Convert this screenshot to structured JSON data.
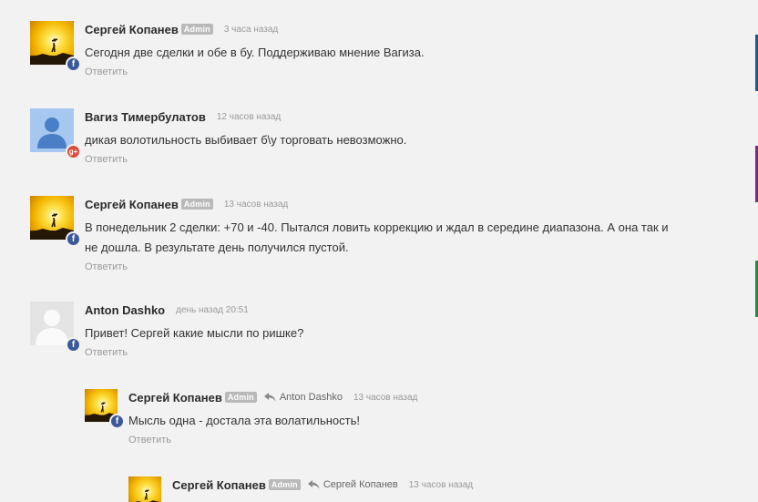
{
  "comments": [
    {
      "author": "Сергей Копанев",
      "badge": "Admin",
      "time": "3 часа назад",
      "text_lines": [
        "Сегодня две сделки и обе в бу. Поддерживаю мнение Вагиза."
      ],
      "reply_label": "Ответить",
      "avatar": "sunset-avatar",
      "network": "facebook"
    },
    {
      "author": "Вагиз Тимербулатов",
      "time": "12 часов назад",
      "text_lines": [
        "дикая волотильность  выбивает б\\у  торговать невозможно."
      ],
      "reply_label": "Ответить",
      "avatar": "default-user-avatar",
      "network": "google-plus"
    },
    {
      "author": "Сергей Копанев",
      "badge": "Admin",
      "time": "13 часов назад",
      "text_lines": [
        "В понедельник 2 сделки: +70 и -40. Пытался ловить коррекцию и ждал в середине диапазона. А она так и",
        "не дошла. В результате день получился пустой."
      ],
      "reply_label": "Ответить",
      "avatar": "sunset-avatar",
      "network": "facebook"
    },
    {
      "author": "Anton Dashko",
      "time": "день назад 20:51",
      "text_lines": [
        "Привет! Сергей какие мысли по ришке?"
      ],
      "reply_label": "Ответить",
      "avatar": "blank-silhouette-avatar",
      "network": "facebook"
    },
    {
      "author": "Сергей Копанев",
      "badge": "Admin",
      "reply_to": "Anton Dashko",
      "time": "13 часов назад",
      "text_lines": [
        "Мысль одна - достала эта волатильность!"
      ],
      "reply_label": "Ответить",
      "avatar": "sunset-avatar",
      "network": "facebook"
    },
    {
      "author": "Сергей Копанев",
      "badge": "Admin",
      "reply_to": "Сергей Копанев",
      "time": "13 часов назад",
      "avatar": "sunset-avatar",
      "network": "facebook"
    }
  ],
  "colors": {
    "facebook": "#3b5998",
    "google_plus": "#dd4b39",
    "admin_badge": "#b9b9b9",
    "muted_text": "#9a9a9a",
    "background": "#f2f2f2"
  }
}
